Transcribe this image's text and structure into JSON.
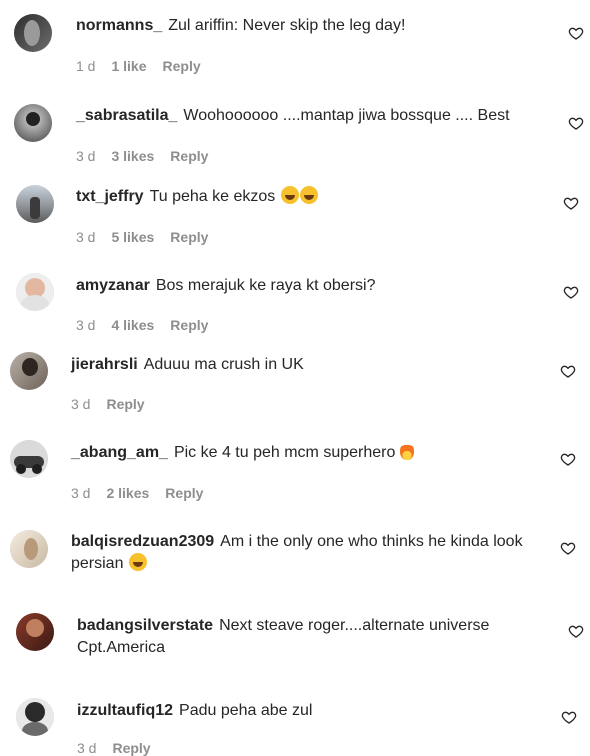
{
  "comments": [
    {
      "username": "normanns_",
      "text": "Zul ariffin: Never skip the leg day!",
      "time": "1 d",
      "likes": "1 like",
      "reply": "Reply",
      "emoji": ""
    },
    {
      "username": "_sabrasatila_",
      "text": "Woohoooooo ....mantap jiwa bossque .... Best",
      "time": "3 d",
      "likes": "3 likes",
      "reply": "Reply",
      "emoji": ""
    },
    {
      "username": "txt_jeffry",
      "text": "Tu peha ke ekzos",
      "time": "3 d",
      "likes": "5 likes",
      "reply": "Reply",
      "emoji": "laugh-emoji-x2"
    },
    {
      "username": "amyzanar",
      "text": "Bos merajuk ke raya kt obersi?",
      "time": "3 d",
      "likes": "4 likes",
      "reply": "Reply",
      "emoji": ""
    },
    {
      "username": "jierahrsli",
      "text": "Aduuu ma crush in UK",
      "time": "3 d",
      "likes": "",
      "reply": "Reply",
      "emoji": ""
    },
    {
      "username": "_abang_am_",
      "text": "Pic ke 4 tu peh mcm superhero",
      "time": "3 d",
      "likes": "2 likes",
      "reply": "Reply",
      "emoji": "fire-emoji"
    },
    {
      "username": "balqisredzuan2309",
      "text": "Am i the only one who thinks he kinda look persian",
      "time": "",
      "likes": "",
      "reply": "",
      "emoji": "laugh-emoji"
    },
    {
      "username": "badangsilverstate",
      "text": "Next steave roger....alternate universe Cpt.America",
      "time": "",
      "likes": "",
      "reply": "",
      "emoji": ""
    },
    {
      "username": "izzultaufiq12",
      "text": "Padu peha abe zul",
      "time": "3 d",
      "likes": "",
      "reply": "Reply",
      "emoji": ""
    }
  ],
  "icons": {
    "like": "heart-outline-icon"
  },
  "colors": {
    "text": "#262626",
    "meta": "#8e8e8e",
    "background": "#ffffff"
  }
}
